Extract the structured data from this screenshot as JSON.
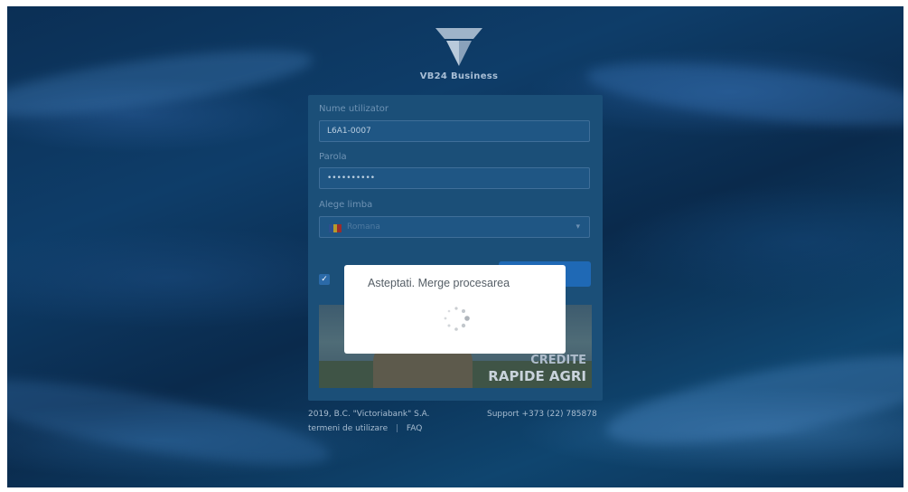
{
  "app": {
    "brand": "VB24 Business"
  },
  "login_form": {
    "username_label": "Nume utilizator",
    "username_value": "L6A1-0007",
    "password_label": "Parola",
    "password_value": "••••••••••",
    "language_label": "Alege limba",
    "language_value": "Romana"
  },
  "banner": {
    "line1": "CREDITE",
    "line2": "RAPIDE AGRI"
  },
  "footer": {
    "copyright": "2019, B.C. \"Victoriabank\" S.A.",
    "support": "Support +373 (22) 785878",
    "terms_link": "termeni de utilizare",
    "separator": "|",
    "faq_link": "FAQ"
  },
  "dialog": {
    "message": "Asteptati. Merge procesarea"
  },
  "colors": {
    "accent": "#1f69b5",
    "brand_bg": "#0b2f55",
    "dialog_bg": "#ffffff"
  },
  "icons": {
    "logo": "victoriabank-v-logo",
    "spinner": "loading-spinner-icon",
    "check": "check-icon"
  }
}
